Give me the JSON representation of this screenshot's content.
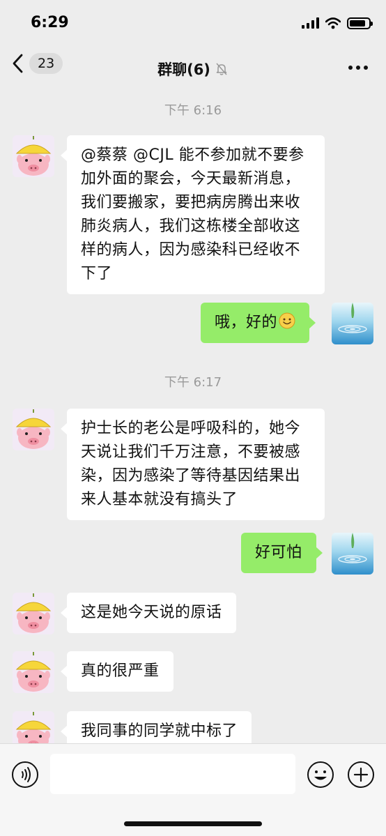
{
  "status_bar": {
    "time": "6:29"
  },
  "nav": {
    "unread_count": "23",
    "title": "群聊(6)"
  },
  "messages": [
    {
      "type": "time",
      "text": "下午 6:16"
    },
    {
      "type": "in",
      "text": "@蔡蔡 @CJL 能不参加就不要参加外面的聚会，今天最新消息，我们要搬家，要把病房腾出来收肺炎病人，我们这栋楼全部收这样的病人，因为感染科已经收不下了"
    },
    {
      "type": "out",
      "text": "哦，好的",
      "emoji": "smile-emoji"
    },
    {
      "type": "time",
      "text": "下午 6:17"
    },
    {
      "type": "in",
      "text": "护士长的老公是呼吸科的，她今天说让我们千万注意，不要被感染，因为感染了等待基因结果出来人基本就没有搞头了"
    },
    {
      "type": "out",
      "text": "好可怕"
    },
    {
      "type": "in",
      "text": "这是她今天说的原话"
    },
    {
      "type": "in",
      "text": "真的很严重"
    },
    {
      "type": "in",
      "text": "我同事的同学就中标了"
    }
  ],
  "input": {
    "value": ""
  },
  "colors": {
    "background": "#ededed",
    "incoming_bubble": "#ffffff",
    "outgoing_bubble": "#95ec69"
  },
  "icons": {
    "back": "chevron-left-icon",
    "mute": "bell-off-icon",
    "more": "more-dots-icon",
    "voice": "voice-icon",
    "emoji": "emoji-icon",
    "plus": "plus-icon",
    "avatar_in": "pig-avatar",
    "avatar_out": "water-drop-avatar"
  }
}
